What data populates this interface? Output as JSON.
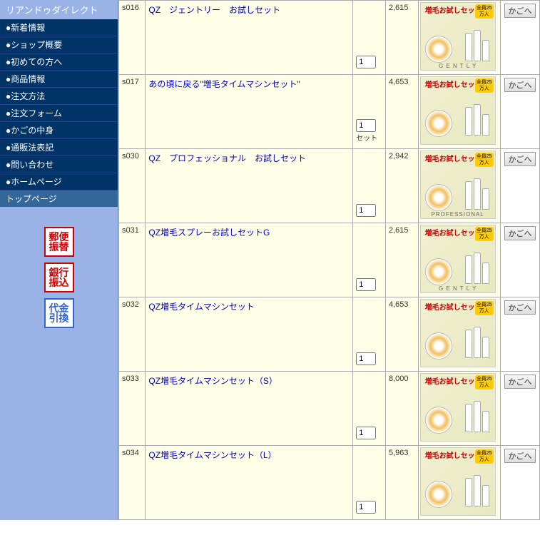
{
  "sidebar": {
    "title": "リアンドゥダイレクト",
    "items": [
      "●新着情報",
      "●ショップ概要",
      "●初めての方へ",
      "●商品情報",
      "●注文方法",
      "●注文フォーム",
      "●かごの中身",
      "●通販法表記",
      "●問い合わせ",
      "●ホームページ"
    ],
    "topPage": "トップページ",
    "paymentIcons": {
      "yubin": "郵便\n振替",
      "ginko": "銀行\n振込",
      "daikin": "代金\n引換"
    }
  },
  "cartLabel": "かごへ",
  "thumbLabel": "増毛お試しセット",
  "thumbBadge": "全員25万人",
  "qtyUnit": "セット",
  "products": [
    {
      "id": "s016",
      "name": "QZ　ジェントリー　お試しセット",
      "price": "2,615",
      "qty": "1",
      "caption": "G E N T L Y",
      "showUnit": false
    },
    {
      "id": "s017",
      "name": "あの頃に戻る\"増毛タイムマシンセット\"",
      "price": "4,653",
      "qty": "1",
      "caption": "",
      "showUnit": true
    },
    {
      "id": "s030",
      "name": "QZ　プロフェッショナル　お試しセット",
      "price": "2,942",
      "qty": "1",
      "caption": "PROFESSIONAL",
      "showUnit": false
    },
    {
      "id": "s031",
      "name": "QZ増毛スプレーお試しセットG",
      "price": "2,615",
      "qty": "1",
      "caption": "G E N T L Y",
      "showUnit": false
    },
    {
      "id": "s032",
      "name": "QZ増毛タイムマシンセット",
      "price": "4,653",
      "qty": "1",
      "caption": "",
      "showUnit": false
    },
    {
      "id": "s033",
      "name": "QZ増毛タイムマシンセット（S）",
      "price": "8,000",
      "qty": "1",
      "caption": "",
      "showUnit": false
    },
    {
      "id": "s034",
      "name": "QZ増毛タイムマシンセット（L）",
      "price": "5,963",
      "qty": "1",
      "caption": "",
      "showUnit": false
    }
  ]
}
